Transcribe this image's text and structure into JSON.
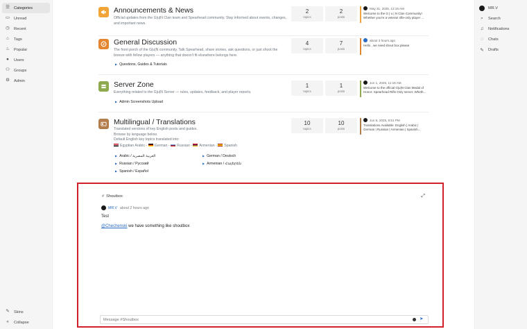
{
  "left_nav": {
    "items": [
      {
        "label": "Categories",
        "icon": "categories-icon",
        "active": true
      },
      {
        "label": "Unread",
        "icon": "inbox-icon"
      },
      {
        "label": "Recent",
        "icon": "clock-icon"
      },
      {
        "label": "Tags",
        "icon": "tag-icon"
      },
      {
        "label": "Popular",
        "icon": "fire-icon"
      },
      {
        "label": "Users",
        "icon": "user-icon"
      },
      {
        "label": "Groups",
        "icon": "group-icon"
      },
      {
        "label": "Admin",
        "icon": "gear-icon"
      }
    ],
    "bottom": [
      {
        "label": "Skins",
        "icon": "paintbrush-icon"
      },
      {
        "label": "Collapse",
        "icon": "collapse-icon"
      }
    ]
  },
  "right_nav": {
    "user": "MR.V",
    "items": [
      {
        "label": "Search",
        "icon": "search-icon"
      },
      {
        "label": "Notifications",
        "icon": "bell-icon"
      },
      {
        "label": "Chats",
        "icon": "chat-icon"
      },
      {
        "label": "Drafts",
        "icon": "pencil-icon"
      }
    ]
  },
  "categories": [
    {
      "title": "Announcements & News",
      "description": "Official updates from the G|u|N Clan team and Spearhead community. Stay informed about events, changes, and important news.",
      "icon": "megaphone-icon",
      "color": "#f0a536",
      "topics": "2",
      "posts": "2",
      "topics_label": "topics",
      "posts_label": "posts",
      "last_time": "May 31, 2025, 12:15 AM",
      "last_text": "Welcome to the G | u | N Clan Community!",
      "last_text2": "Whether you're a veteran rifle-only player ..."
    },
    {
      "title": "General Discussion",
      "description": "The front porch of the G|u|N community. Talk Spearhead, share stories, ask questions, or just shoot the breeze with fellow players — anything that doesn't fit elsewhere belongs here.",
      "icon": "compass-icon",
      "color": "#e3862f",
      "topics": "4",
      "posts": "7",
      "topics_label": "topics",
      "posts_label": "posts",
      "last_time": "about 3 hours ago",
      "last_text": "Hello , we need shout box please",
      "subcategories": [
        "Questions, Guides & Tutorials"
      ]
    },
    {
      "title": "Server Zone",
      "description": "Everything related to the G|u|N Server — rules, updates, feedback, and player reports.",
      "icon": "server-icon",
      "color": "#8faa4e",
      "topics": "1",
      "posts": "1",
      "topics_label": "topics",
      "posts_label": "posts",
      "last_time": "Jun 1, 2025, 11:18 AM",
      "last_text": "Welcome to the official G|u|N Clan Medal of",
      "last_text2": "Honor: Spearhead Rifle Only server. Wheth...",
      "subcategories": [
        "Admin Screenshots Upload"
      ]
    },
    {
      "title": "Multilingual / Translations",
      "description_lines": [
        "Translated versions of key English posts and guides.",
        "Browse by language below.",
        "Default English key topics translated into:"
      ],
      "languages": [
        "Egyptian Arabic",
        "German",
        "Russian",
        "Armenian",
        "Spanish"
      ],
      "icon": "id-card-icon",
      "color": "#b37d4c",
      "topics": "10",
      "posts": "10",
      "topics_label": "topics",
      "posts_label": "posts",
      "last_time": "Jun 6, 2025, 8:51 PM",
      "last_text": "Translations Available: English | Arabic |",
      "last_text2": "German | Russian | Armenian | Spanish...",
      "subcategories": [
        "Arabic / العربية المصرية",
        "German / Deutsch",
        "Russian / Русский",
        "Armenian / Հայերեն",
        "Spanish / Español"
      ]
    }
  ],
  "shoutbox": {
    "title": "Shoutbox",
    "user": "MR.V",
    "time": "about 2 hours ago",
    "message1": "Test",
    "mention": "@Chechenski",
    "message2": " we have something like shoutbox",
    "placeholder": "Message #Shoutbox"
  }
}
